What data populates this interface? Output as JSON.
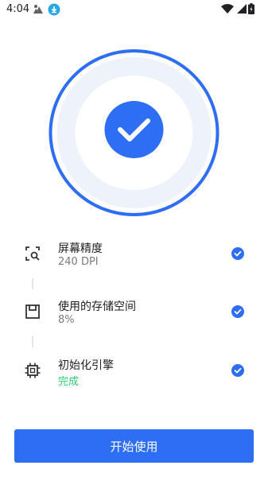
{
  "status_bar": {
    "time": "4:04",
    "icons": [
      "notification-icon",
      "download-icon",
      "wifi-icon",
      "signal-icon",
      "battery-icon"
    ]
  },
  "hero": {
    "icon": "checkmark-circle-icon",
    "colors": {
      "ring": "#2d6ef5",
      "halo": "#eef2fb",
      "center": "#2d6ef5"
    }
  },
  "steps": [
    {
      "title": "屏幕精度",
      "subtitle": "240 DPI",
      "icon": "screen-search-icon",
      "status_icon": "check-circle-icon"
    },
    {
      "title": "使用的存储空间",
      "subtitle": "8%",
      "icon": "storage-icon",
      "status_icon": "check-circle-icon"
    },
    {
      "title": "初始化引擎",
      "subtitle": "完成",
      "icon": "chip-icon",
      "status_icon": "check-circle-icon"
    }
  ],
  "colors": {
    "accent": "#2d6ef5",
    "done_text": "#2ecc71"
  },
  "start_button": {
    "label": "开始使用"
  }
}
